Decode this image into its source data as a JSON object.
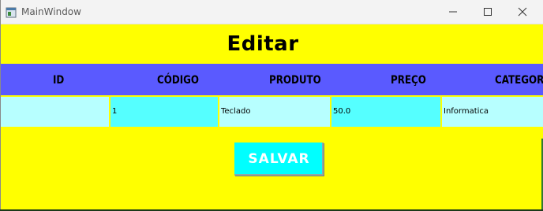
{
  "window": {
    "title": "MainWindow",
    "icon": "app-window-icon",
    "controls": [
      "minimize-icon",
      "maximize-icon",
      "close-icon"
    ]
  },
  "page": {
    "heading": "Editar"
  },
  "table": {
    "columns": [
      "ID",
      "CÓDIGO",
      "PRODUTO",
      "PREÇO",
      "CATEGORI"
    ],
    "row": {
      "id": "",
      "codigo": "1",
      "produto": "Teclado",
      "preco": "50.0",
      "categoria": "Informatica"
    }
  },
  "actions": {
    "save_label": "SALVAR"
  },
  "colors": {
    "background": "#ffff00",
    "header": "#5a5aff",
    "cell_light": "#b7ffff",
    "cell_cyan": "#55ffff",
    "button": "#00ffff"
  }
}
